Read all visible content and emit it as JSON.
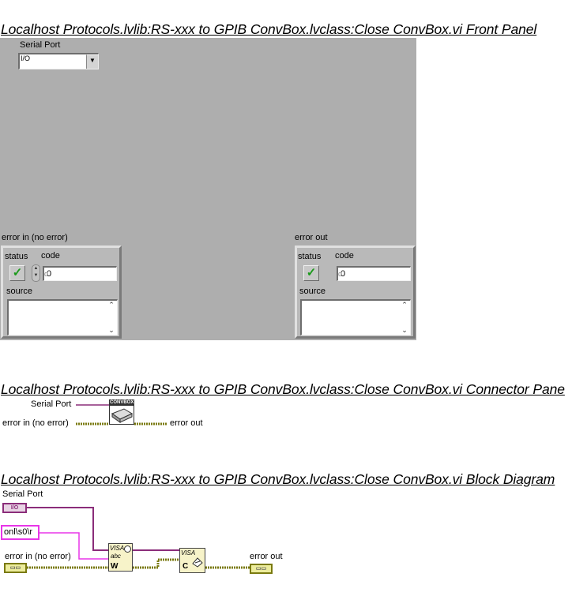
{
  "front_panel": {
    "title": "Localhost Protocols.lvlib:RS-xxx to GPIB ConvBox.lvclass:Close ConvBox.vi Front Panel",
    "serial_port": {
      "label": "Serial Port",
      "io_glyph": "I/O",
      "value": ""
    },
    "error_in": {
      "label": "error in (no error)",
      "status_label": "status",
      "code_label": "code",
      "code_value": "0",
      "code_radix": "d",
      "source_label": "source",
      "source_value": ""
    },
    "error_out": {
      "label": "error out",
      "status_label": "status",
      "code_label": "code",
      "code_value": "0",
      "code_radix": "d",
      "source_label": "source",
      "source_value": ""
    }
  },
  "connector_pane": {
    "title": "Localhost Protocols.lvlib:RS-xxx to GPIB ConvBox.lvclass:Close ConvBox.vi Connector Pane",
    "input_serial_port": "Serial Port",
    "input_error_in": "error in (no error)",
    "output_error_out": "error out",
    "icon_text": "CONVBOX"
  },
  "block_diagram": {
    "title": "Localhost Protocols.lvlib:RS-xxx to GPIB ConvBox.lvclass:Close ConvBox.vi Block Diagram",
    "serial_port_label": "Serial Port",
    "serial_port_terminal": "I/O",
    "string_constant": "onl\\s0\\r",
    "error_in_label": "error in (no error)",
    "error_out_label": "error out",
    "visa_write_node": {
      "tag": "VISA",
      "sub": "abc",
      "mode": "W"
    },
    "visa_close_node": {
      "tag": "VISA",
      "sub": "C"
    }
  },
  "colors": {
    "panel_bg": "#aeaeae",
    "visa_wire": "#8b2d7a",
    "string_wire": "#e836e8",
    "error_wire": "#7a7a10",
    "check_green": "#1a9a1a"
  }
}
